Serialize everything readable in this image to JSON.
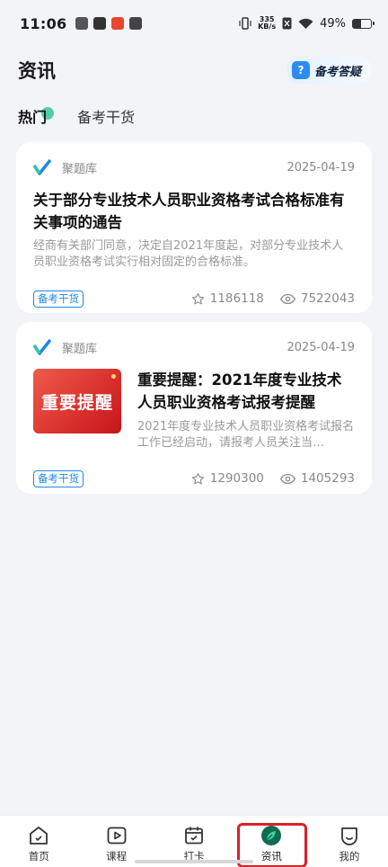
{
  "status_bar": {
    "time": "11:06",
    "net_speed_value": "335",
    "net_speed_unit": "KB/s",
    "battery": "49%"
  },
  "header": {
    "title": "资讯",
    "qa_button": "备考答疑"
  },
  "tabs": [
    {
      "label": "热门",
      "active": true
    },
    {
      "label": "备考干货",
      "active": false
    }
  ],
  "articles": [
    {
      "source": "聚题库",
      "date": "2025-04-19",
      "title": "关于部分专业技术人员职业资格考试合格标准有关事项的通告",
      "description": "经商有关部门同意，决定自2021年度起，对部分专业技术人员职业资格考试实行相对固定的合格标准。",
      "tag": "备考干货",
      "likes": "1186118",
      "views": "7522043"
    },
    {
      "source": "聚题库",
      "date": "2025-04-19",
      "thumbnail_text": "重要提醒",
      "title": "重要提醒：2021年度专业技术人员职业资格考试报考提醒",
      "description": "2021年度专业技术人员职业资格考试报名工作已经启动，请报考人员关注当…",
      "tag": "备考干货",
      "likes": "1290300",
      "views": "1405293"
    }
  ],
  "bottom_nav": [
    {
      "label": "首页",
      "icon": "home-icon"
    },
    {
      "label": "课程",
      "icon": "play-icon"
    },
    {
      "label": "打卡",
      "icon": "calendar-check-icon"
    },
    {
      "label": "资讯",
      "icon": "leaf-icon",
      "active": true
    },
    {
      "label": "我的",
      "icon": "profile-icon"
    }
  ],
  "colors": {
    "accent": "#1e88e5",
    "highlight": "#d6222b",
    "active_nav": "#0f6b52"
  }
}
